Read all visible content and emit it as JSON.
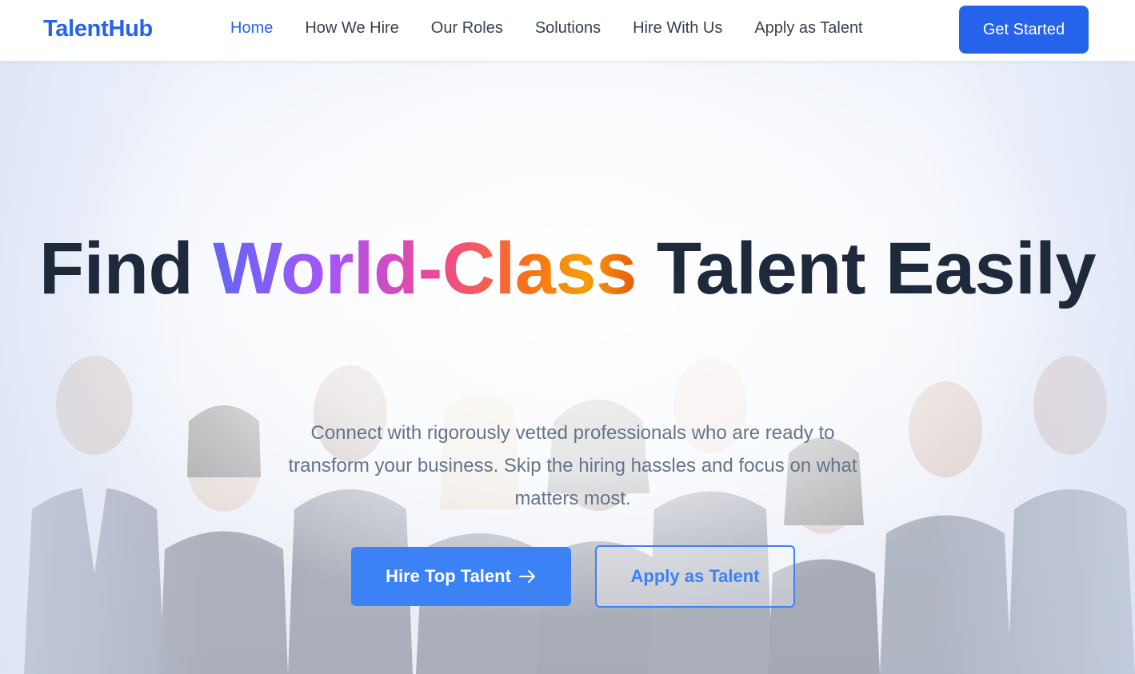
{
  "brand": {
    "name": "TalentHub",
    "color": "#2563eb"
  },
  "nav": {
    "items": [
      {
        "label": "Home",
        "active": true
      },
      {
        "label": "How We Hire",
        "active": false
      },
      {
        "label": "Our Roles",
        "active": false
      },
      {
        "label": "Solutions",
        "active": false
      },
      {
        "label": "Hire With Us",
        "active": false
      },
      {
        "label": "Apply as Talent",
        "active": false
      }
    ],
    "cta_label": "Get Started"
  },
  "hero": {
    "headline_start": "Find ",
    "headline_highlight": "World-Class",
    "headline_end": " Talent Easily",
    "subtext": "Connect with rigorously vetted professionals who are ready to transform your business. Skip the hiring hassles and focus on what matters most.",
    "primary_button": {
      "label": "Hire Top Talent",
      "icon": "arrow-right-icon"
    },
    "secondary_button": {
      "label": "Apply as Talent"
    },
    "background": "team-photo"
  },
  "colors": {
    "accent": "#2563eb",
    "button": "#3b82f6",
    "heading": "#1e293b",
    "body_text": "#64748b",
    "gradient": [
      "#6366f1",
      "#a855f7",
      "#ec4899",
      "#f97316",
      "#f59e0b"
    ]
  }
}
